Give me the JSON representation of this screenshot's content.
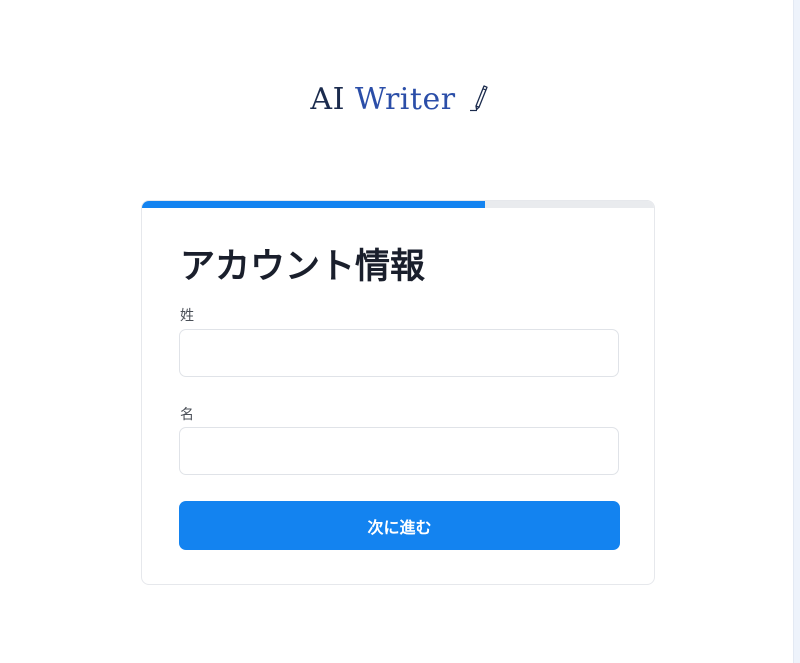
{
  "logo": {
    "text_ai": "AI",
    "text_writer": "Writer",
    "icon": "pencil-icon"
  },
  "form": {
    "title": "アカウント情報",
    "progress": 0.67,
    "fields": [
      {
        "label": "姓",
        "value": "",
        "placeholder": ""
      },
      {
        "label": "名",
        "value": "",
        "placeholder": ""
      }
    ],
    "next_label": "次に進む"
  },
  "colors": {
    "accent": "#1383f0",
    "progress_track": "#e9ebee",
    "logo_dark": "#1b2b4d",
    "logo_blue": "#2b4ea8"
  }
}
